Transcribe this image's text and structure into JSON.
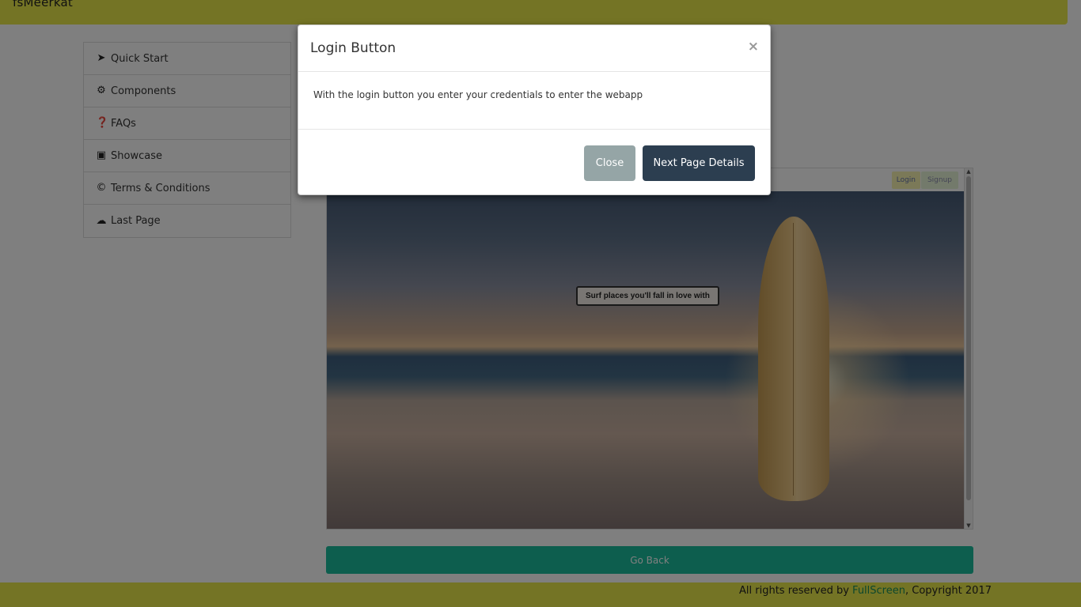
{
  "app": {
    "brand": "fsMeerkat"
  },
  "sidebar": {
    "items": [
      {
        "icon": "paper-plane-icon",
        "glyph": "➤",
        "label": "Quick Start"
      },
      {
        "icon": "gear-icon",
        "glyph": "⚙",
        "label": "Components"
      },
      {
        "icon": "question-circle-icon",
        "glyph": "❓",
        "label": "FAQs"
      },
      {
        "icon": "picture-icon",
        "glyph": "▣",
        "label": "Showcase"
      },
      {
        "icon": "copyright-icon",
        "glyph": "©",
        "label": "Terms & Conditions"
      },
      {
        "icon": "cloud-download-icon",
        "glyph": "☁",
        "label": "Last Page"
      }
    ]
  },
  "preview": {
    "nav_login": "Login",
    "nav_signup": "Signup",
    "caption": "Surf places you'll fall in love with"
  },
  "main": {
    "go_back_label": "Go Back"
  },
  "footer": {
    "prefix": "All rights reserved by ",
    "link": "FullScreen",
    "suffix": ", Copyright 2017"
  },
  "modal": {
    "title": "Login Button",
    "close_glyph": "×",
    "body": "With the login button you enter your credentials to enter the webapp",
    "close_label": "Close",
    "next_label": "Next Page Details"
  },
  "colors": {
    "topbar": "#e8e84a",
    "go_back": "#1abc9c",
    "btn_close": "#95a5a6",
    "btn_next": "#2c3e50",
    "footer_link": "#1a8f5a"
  }
}
